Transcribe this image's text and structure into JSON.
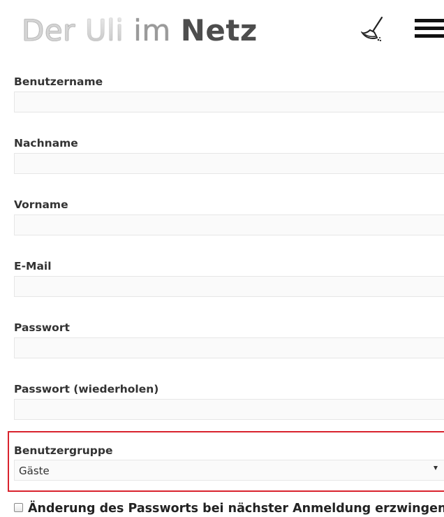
{
  "header": {
    "title_parts": [
      "Der",
      "Uli",
      "im",
      "Netz"
    ],
    "broom_icon": "broom-icon",
    "menu_icon": "hamburger-menu-icon"
  },
  "form": {
    "fields": [
      {
        "label": "Benutzername",
        "value": ""
      },
      {
        "label": "Nachname",
        "value": ""
      },
      {
        "label": "Vorname",
        "value": ""
      },
      {
        "label": "E-Mail",
        "value": ""
      },
      {
        "label": "Passwort",
        "value": ""
      },
      {
        "label": "Passwort (wiederholen)",
        "value": ""
      }
    ],
    "group": {
      "label": "Benutzergruppe",
      "selected": "Gäste",
      "highlight_color": "#d9232d"
    },
    "force_password_change": {
      "label": "Änderung des Passworts bei nächster Anmeldung erzwingen",
      "checked": false
    }
  }
}
